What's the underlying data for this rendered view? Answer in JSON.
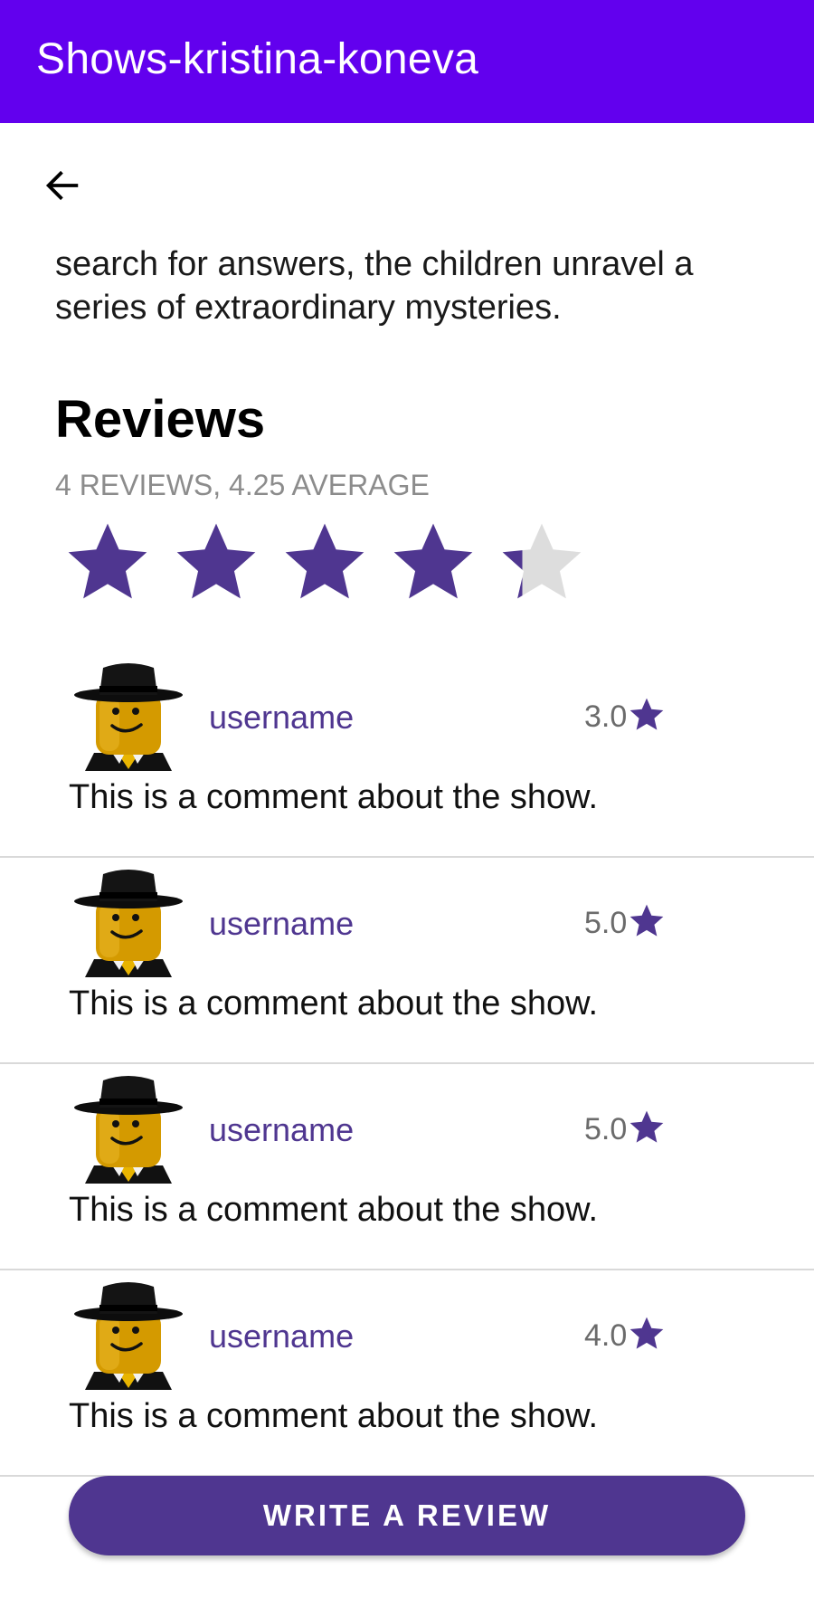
{
  "app_bar": {
    "title": "Shows-kristina-koneva",
    "color": "#6200ee"
  },
  "toolbar": {
    "back_icon": "arrow-left-icon"
  },
  "show": {
    "description_tail": "search for answers, the children unravel a series of extraordinary mysteries."
  },
  "reviews": {
    "heading": "Reviews",
    "summary": "4 REVIEWS, 4.25 AVERAGE",
    "average_rating": 4.25,
    "max_rating": 5,
    "star_color": "#4f3690",
    "empty_star_color": "#dddddd",
    "items": [
      {
        "avatar_icon": "lego-minifigure-avatar",
        "username": "username",
        "rating": "3.0",
        "comment": "This is a comment about the show."
      },
      {
        "avatar_icon": "lego-minifigure-avatar",
        "username": "username",
        "rating": "5.0",
        "comment": "This is a comment about the show."
      },
      {
        "avatar_icon": "lego-minifigure-avatar",
        "username": "username",
        "rating": "5.0",
        "comment": "This is a comment about the show."
      },
      {
        "avatar_icon": "lego-minifigure-avatar",
        "username": "username",
        "rating": "4.0",
        "comment": "This is a comment about the show."
      }
    ]
  },
  "write_review_button": {
    "label": "WRITE A REVIEW",
    "color": "#4f3690"
  }
}
